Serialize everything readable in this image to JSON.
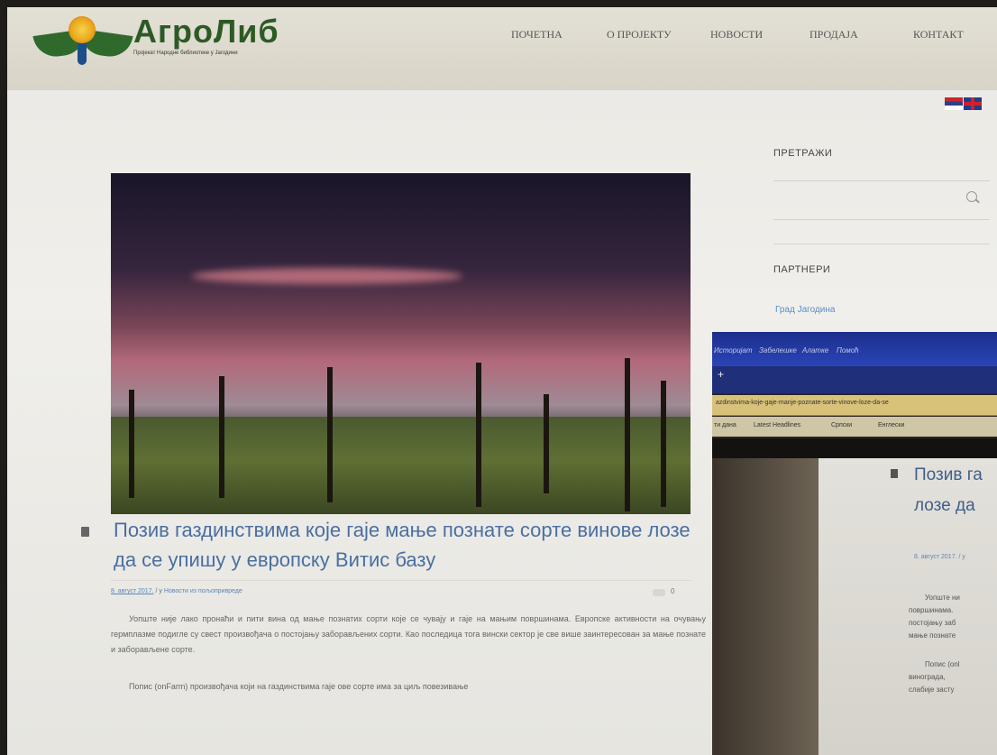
{
  "brand": {
    "name": "АгроЛиб",
    "tagline": "Пројекат Народне библиотеке у Јагодини"
  },
  "nav": [
    "ПОЧЕТНА",
    "О ПРОЈЕКТУ",
    "НОВОСТИ",
    "ПРОДАЈА",
    "КОНТАКТ"
  ],
  "sidebar": {
    "search_heading": "ПРЕТРАЖИ",
    "partners_heading": "ПАРТНЕРИ",
    "partner_link": "Град Јагодина"
  },
  "post": {
    "title": "Позив газдинствима које гаје мање познате сорте винове лозе да се упишу у европску Витис базу",
    "date": "8. август 2017.",
    "meta_sep": " / у ",
    "category": "Новости из пољопривреде",
    "comments": "0",
    "paragraphs": [
      "Уопште није лако пронаћи и пити вина од мање познатих сорти које се чувају и гаје на мањим површинама. Европске активности на очувању гермплазме подигле су свест произвођача о постојању заборављених сорти. Као последица тога вински сектор је све више заинтересован за мање познате и заборављене сорте.",
      "Попис (onFarm) произвођача који на газдинствима гаје ове сорте има за циљ повезивање"
    ]
  },
  "photo": {
    "menu": [
      "Историјат",
      "Забелешке",
      "Алатке",
      "Помоћ"
    ],
    "url": "azdinstvima-koje-gaje-manje-poznate-sorte-vinove-loze-da-se",
    "bookmarks": [
      "ти дана",
      "Latest Headlines",
      "Српски",
      "Енглески"
    ],
    "title_lines": [
      "Позив га",
      "лозе да"
    ],
    "meta": "8. август 2017. / у",
    "para_lines": [
      "Уопште ни",
      "површинама.",
      "постојању заб",
      "мање познате",
      "Попис (onl",
      "винограда,",
      "слабије засту"
    ]
  }
}
